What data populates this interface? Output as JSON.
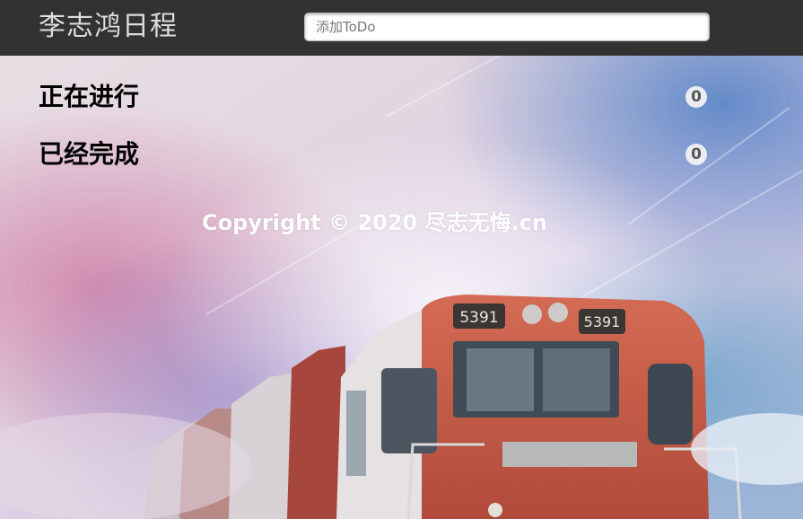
{
  "header": {
    "title": "李志鸿日程",
    "todo_placeholder": "添加ToDo",
    "todo_value": ""
  },
  "sections": [
    {
      "title": "正在进行",
      "count": "0"
    },
    {
      "title": "已经完成",
      "count": "0"
    }
  ],
  "footer": {
    "copyright": "Copyright © 2020 尽志无悔.cn"
  },
  "colors": {
    "header_bg": "#323232",
    "brand_text": "#dddddd",
    "footer_text": "#ffffff"
  },
  "background": {
    "locomotive_plate_left": "5391",
    "locomotive_plate_right": "5391"
  }
}
